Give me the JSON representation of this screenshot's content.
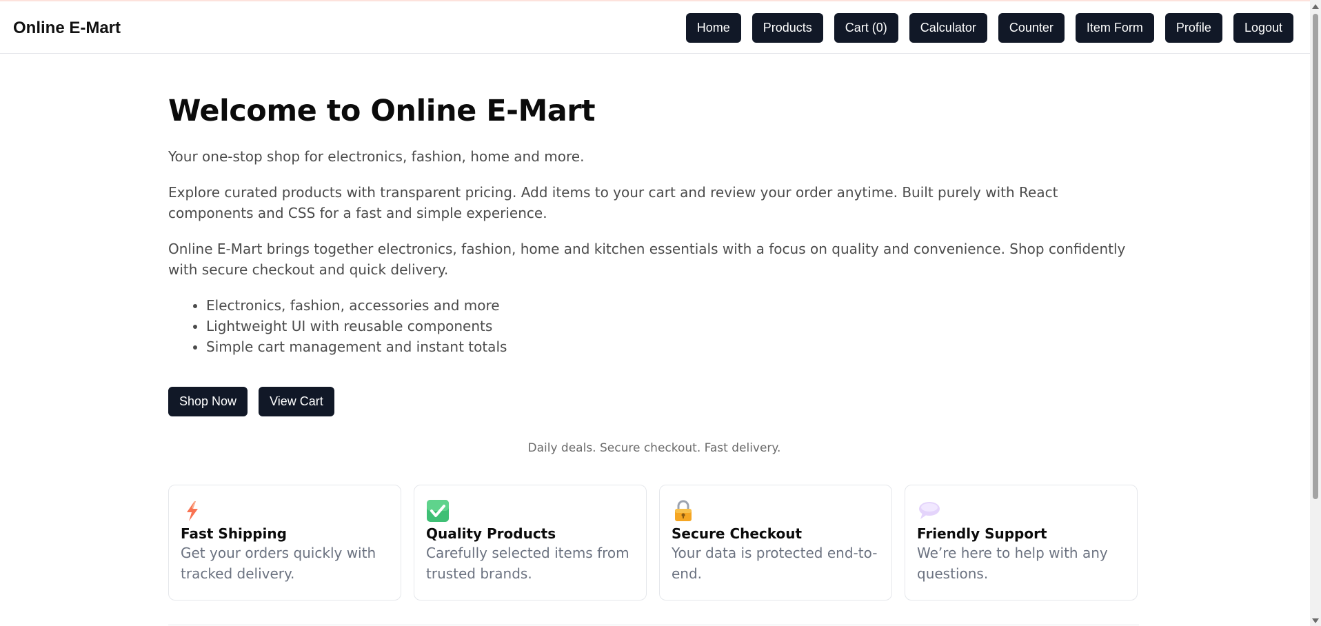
{
  "brand": "Online E-Mart",
  "nav": {
    "items": [
      "Home",
      "Products",
      "Cart (0)",
      "Calculator",
      "Counter",
      "Item Form",
      "Profile",
      "Logout"
    ]
  },
  "hero": {
    "title": "Welcome to Online E-Mart",
    "tagline": "Your one-stop shop for electronics, fashion, home and more.",
    "description1": "Explore curated products with transparent pricing. Add items to your cart and review your order anytime. Built purely with React components and CSS for a fast and simple experience.",
    "description2": "Online E-Mart brings together electronics, fashion, home and kitchen essentials with a focus on quality and convenience. Shop confidently with secure checkout and quick delivery.",
    "features": [
      "Electronics, fashion, accessories and more",
      "Lightweight UI with reusable components",
      "Simple cart management and instant totals"
    ],
    "buttons": {
      "shop_now": "Shop Now",
      "view_cart": "View Cart"
    },
    "note": "Daily deals. Secure checkout. Fast delivery."
  },
  "cards": [
    {
      "icon": "lightning-icon",
      "title": "Fast Shipping",
      "text": "Get your orders quickly with tracked delivery."
    },
    {
      "icon": "checkmark-icon",
      "title": "Quality Products",
      "text": "Carefully selected items from trusted brands."
    },
    {
      "icon": "lock-icon",
      "title": "Secure Checkout",
      "text": "Your data is protected end-to-end."
    },
    {
      "icon": "speech-bubble-icon",
      "title": "Friendly Support",
      "text": "We’re here to help with any questions."
    }
  ],
  "colors": {
    "button_bg": "#111827",
    "button_text": "#ffffff",
    "muted_text": "#4b4b4b",
    "card_text": "#6b7280",
    "border": "#e5e7eb"
  }
}
